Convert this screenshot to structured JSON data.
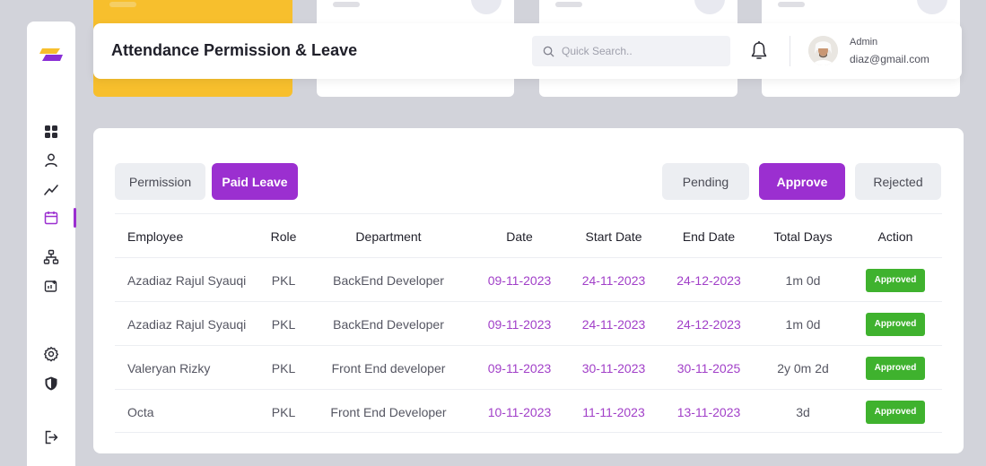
{
  "header": {
    "title": "Attendance Permission & Leave",
    "search_placeholder": "Quick Search..",
    "user": {
      "role": "Admin",
      "email": "diaz@gmail.com"
    }
  },
  "sidebar": {
    "icons": [
      "dashboard-icon",
      "user-icon",
      "chart-line-icon",
      "calendar-icon",
      "org-chart-icon",
      "report-icon",
      "settings-icon",
      "shield-icon",
      "logout-icon"
    ],
    "active": "calendar-icon"
  },
  "tabs": {
    "permission": "Permission",
    "paid_leave": "Paid Leave",
    "active": "Paid Leave"
  },
  "filters": {
    "pending": "Pending",
    "approve": "Approve",
    "rejected": "Rejected",
    "active": "Approve"
  },
  "table": {
    "columns": [
      "Employee",
      "Role",
      "Department",
      "Date",
      "Start Date",
      "End Date",
      "Total Days",
      "Action"
    ],
    "rows": [
      {
        "employee": "Azadiaz Rajul Syauqi",
        "role": "PKL",
        "department": "BackEnd Developer",
        "date": "09-11-2023",
        "start": "24-11-2023",
        "end": "24-12-2023",
        "total": "1m 0d",
        "status": "Approved"
      },
      {
        "employee": "Azadiaz Rajul Syauqi",
        "role": "PKL",
        "department": "BackEnd Developer",
        "date": "09-11-2023",
        "start": "24-11-2023",
        "end": "24-12-2023",
        "total": "1m 0d",
        "status": "Approved"
      },
      {
        "employee": "Valeryan Rizky",
        "role": "PKL",
        "department": "Front End developer",
        "date": "09-11-2023",
        "start": "30-11-2023",
        "end": "30-11-2025",
        "total": "2y 0m 2d",
        "status": "Approved"
      },
      {
        "employee": "Octa",
        "role": "PKL",
        "department": "Front End Developer",
        "date": "10-11-2023",
        "start": "11-11-2023",
        "end": "13-11-2023",
        "total": "3d",
        "status": "Approved"
      }
    ]
  },
  "colors": {
    "accent": "#9b2fd0",
    "success": "#3fb22e",
    "stat_card_highlight": "#f7bf2d",
    "background": "#d2d3da"
  }
}
